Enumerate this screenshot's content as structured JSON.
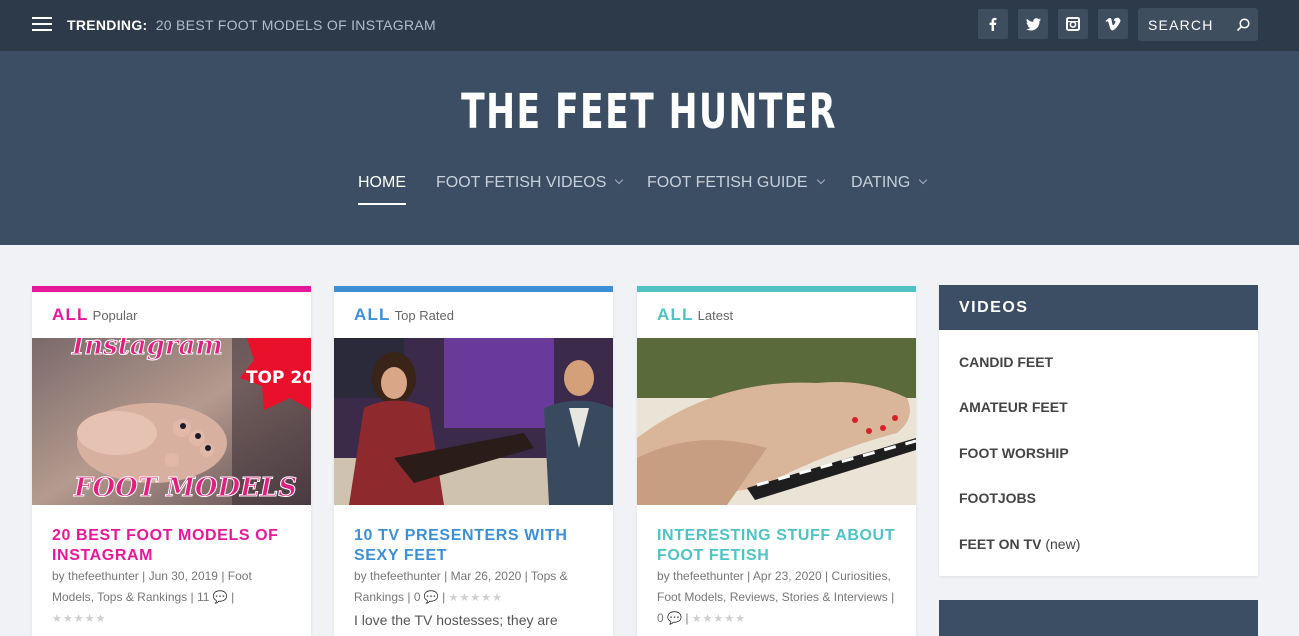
{
  "topbar": {
    "trending_label": "TRENDING:",
    "trending_link": "20 BEST FOOT MODELS OF INSTAGRAM",
    "social": [
      "facebook-icon",
      "twitter-icon",
      "instagram-icon",
      "vimeo-icon"
    ],
    "search_placeholder": "SEARCH"
  },
  "header": {
    "logo": "THE FEET HUNTER",
    "nav": [
      {
        "label": "HOME",
        "active": true
      },
      {
        "label": "FOOT FETISH VIDEOS",
        "dropdown": true
      },
      {
        "label": "FOOT FETISH GUIDE",
        "dropdown": true
      },
      {
        "label": "DATING",
        "dropdown": true
      }
    ]
  },
  "cards": [
    {
      "color": "#e5189a",
      "category": "ALL",
      "tab": "Popular",
      "title": "20 BEST FOOT MODELS OF INSTAGRAM",
      "author": "thefeethunter",
      "date": "Jun 30, 2019",
      "cats": "Foot Models, Tops & Rankings",
      "comments": "11",
      "image_text_top": "Instagram",
      "image_text_badge": "TOP 20",
      "image_text_bottom": "FOOT MODELS"
    },
    {
      "color": "#3d8fd6",
      "category": "ALL",
      "tab": "Top Rated",
      "title": "10 TV PRESENTERS WITH SEXY FEET",
      "author": "thefeethunter",
      "date": "Mar 26, 2020",
      "cats": "Tops & Rankings",
      "comments": "0",
      "excerpt": "I love the TV hostesses; they are"
    },
    {
      "color": "#4fc3c3",
      "category": "ALL",
      "tab": "Latest",
      "title": "INTERESTING STUFF ABOUT FOOT FETISH",
      "author": "thefeethunter",
      "date": "Apr 23, 2020",
      "cats": "Curiosities, Foot Models, Reviews, Stories & Interviews",
      "comments": "0"
    }
  ],
  "sidebar": {
    "title": "VIDEOS",
    "items": [
      "CANDID FEET",
      "AMATEUR FEET",
      "FOOT WORSHIP",
      "FOOTJOBS",
      "FEET ON TV"
    ],
    "new_tag": "(new)"
  },
  "meta": {
    "by": "by",
    "sep": "|"
  }
}
